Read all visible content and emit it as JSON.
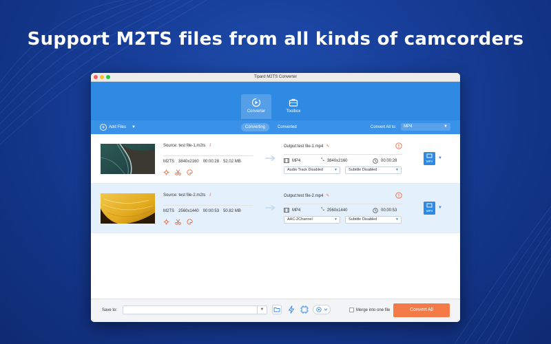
{
  "headline": "Support M2TS files from all kinds of camcorders",
  "window": {
    "title": "Tipard M2TS Converter"
  },
  "nav": {
    "tabs": [
      {
        "label": "Converter",
        "icon": "converter-icon",
        "active": true
      },
      {
        "label": "Toolbox",
        "icon": "toolbox-icon",
        "active": false
      }
    ]
  },
  "toolbar": {
    "add_files": "Add Files",
    "segments": [
      "Converting",
      "Converted"
    ],
    "convert_all_to_label": "Convert All to:",
    "convert_all_to_value": "MP4"
  },
  "files": [
    {
      "source": "Source: test file-1.m2ts",
      "src_format": "M2TS",
      "src_resolution": "3840x2160",
      "src_duration": "00:00:28",
      "src_size": "52.02 MB",
      "output": "Output:test file-1.mp4",
      "out_format": "MP4",
      "out_resolution": "3840x2160",
      "out_duration": "00:00:28",
      "audio": "Audio Track Disabled",
      "subtitle": "Subtitle Disabled",
      "badge": "MP4",
      "thumb": "aerial-coast"
    },
    {
      "source": "Source: test file-2.m2ts",
      "src_format": "M2TS",
      "src_resolution": "2560x1440",
      "src_duration": "00:00:53",
      "src_size": "50.82 MB",
      "output": "Output:test file-2.mp4",
      "out_format": "MP4",
      "out_resolution": "2560x1440",
      "out_duration": "00:00:53",
      "audio": "AAC-2Channel",
      "subtitle": "Subtitle Disabled",
      "badge": "MP4",
      "thumb": "yellow-texture"
    }
  ],
  "bottom": {
    "save_to_label": "Save to:",
    "save_to_value": "",
    "merge_label": "Merge into one file",
    "convert_all_label": "Convert All"
  },
  "colors": {
    "accent": "#2f8ae3",
    "convert_button": "#f47a48",
    "background": "#163c95"
  }
}
